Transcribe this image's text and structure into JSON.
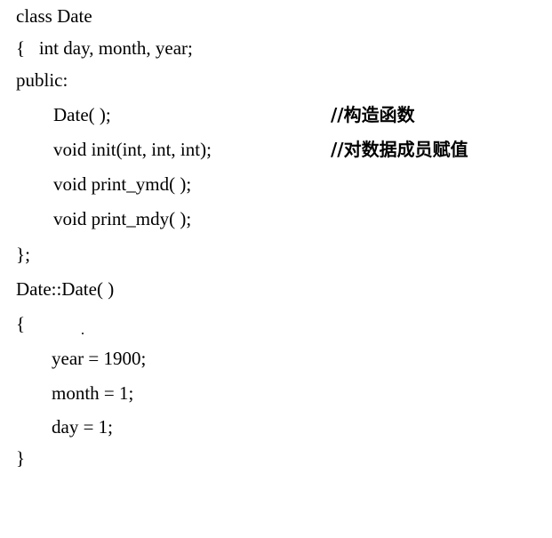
{
  "code": {
    "lines": [
      "class Date",
      "{   int day, month, year;",
      "public:",
      "Date( );",
      "void init(int, int, int);",
      "void print_ymd( );",
      "void print_mdy( );",
      "};",
      "Date::Date( )",
      "{",
      "year = 1900;",
      "month = 1;",
      "day = 1;",
      "}"
    ],
    "comments": {
      "constructor": "//构造函数",
      "init": "//对数据成员赋值"
    }
  }
}
